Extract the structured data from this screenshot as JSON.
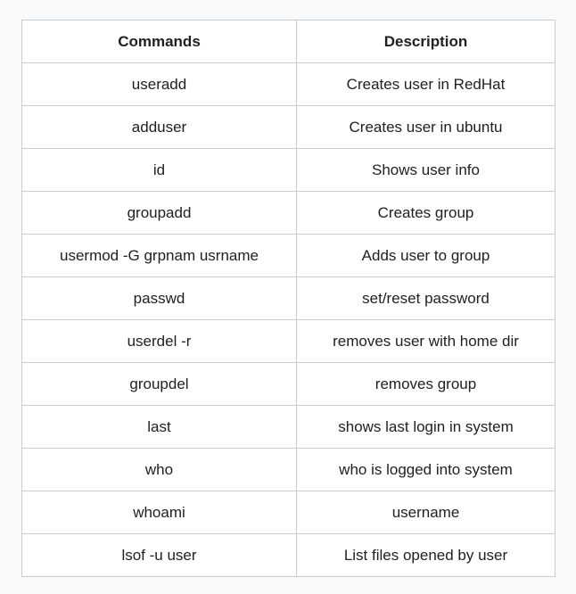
{
  "table": {
    "headers": [
      "Commands",
      "Description"
    ],
    "rows": [
      [
        "useradd",
        "Creates user in RedHat"
      ],
      [
        "adduser",
        "Creates user in ubuntu"
      ],
      [
        "id",
        "Shows user info"
      ],
      [
        "groupadd",
        "Creates group"
      ],
      [
        "usermod -G grpnam usrname",
        "Adds user to group"
      ],
      [
        "passwd",
        "set/reset password"
      ],
      [
        "userdel -r",
        "removes user with home dir"
      ],
      [
        "groupdel",
        "removes group"
      ],
      [
        "last",
        "shows last login in system"
      ],
      [
        "who",
        "who is logged into system"
      ],
      [
        "whoami",
        "username"
      ],
      [
        "lsof -u user",
        "List files opened by user"
      ]
    ]
  }
}
